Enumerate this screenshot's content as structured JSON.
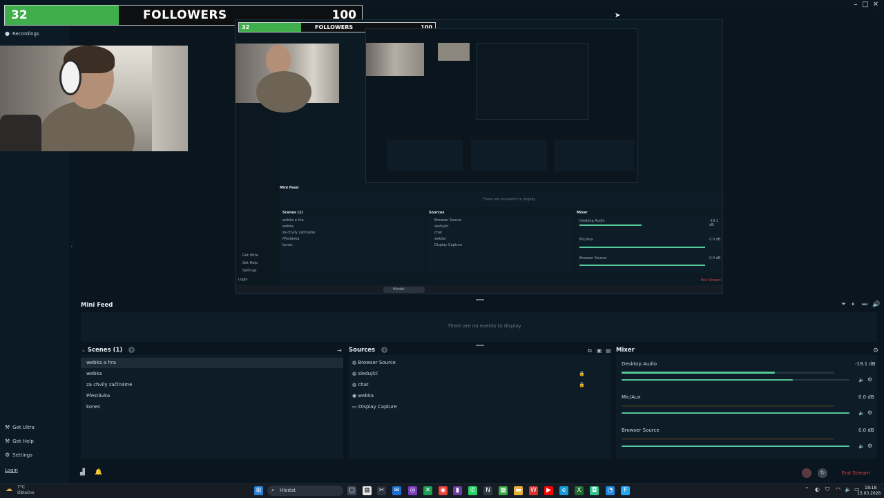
{
  "overlay": {
    "current": "32",
    "label": "FOLLOWERS",
    "goal": "100",
    "progress": 0.32
  },
  "leftnav": {
    "recordings": "Recordings",
    "get_ultra": "Get Ultra",
    "get_help": "Get Help",
    "settings": "Settings",
    "login": "Login"
  },
  "minifeed": {
    "title": "Mini Feed",
    "empty": "There are no events to display"
  },
  "scenes": {
    "title": "Scenes (1)",
    "items": [
      "webka a hra",
      "webka",
      "za chvíly začínáme",
      "Přestávka",
      "konec"
    ]
  },
  "sources": {
    "title": "Sources",
    "items": [
      "Browser Source",
      "sledující",
      "chat",
      "webka",
      "Display Capture"
    ]
  },
  "mixer": {
    "title": "Mixer",
    "channels": [
      {
        "name": "Desktop Audio",
        "db": "-19.1 dB",
        "level": 0.72,
        "vol": 0.75
      },
      {
        "name": "Mic/Aux",
        "db": "0.0 dB",
        "level": 0.0,
        "vol": 1.0
      },
      {
        "name": "Browser Source",
        "db": "0.0 dB",
        "level": 0.0,
        "vol": 1.0
      }
    ]
  },
  "footer": {
    "end_stream": "End Stream"
  },
  "taskbar": {
    "weather_temp": "7°C",
    "weather_desc": "Oblačno",
    "search": "Hledat",
    "time": "18:18",
    "date": "15.03.2026"
  },
  "colors": {
    "accent": "#55c99a",
    "overlay_fill": "#3fae4b",
    "end_stream": "#d9454a",
    "background": "#09161f"
  },
  "nested": {
    "overlay_current": "32",
    "overlay_label": "FOLLOWERS",
    "overlay_goal": "100",
    "minifeed": "Mini Feed",
    "minifeed_empty": "There are no events to display",
    "scenes": "Scenes (1)",
    "scene_items": [
      "webka a hra",
      "webka",
      "za chvíly začínáme",
      "Přestávka",
      "konec"
    ],
    "sources": "Sources",
    "source_items": [
      "Browser Source",
      "sledující",
      "chat",
      "webka",
      "Display Capture"
    ],
    "mixer": "Mixer",
    "mixer_items": [
      "Desktop Audio",
      "Mic/Aux",
      "Browser Source"
    ],
    "mixer_db": [
      "-19.1 dB",
      "0.0 dB",
      "0.0 dB"
    ],
    "end_stream": "End Stream",
    "get_ultra": "Get Ultra",
    "get_help": "Get Help",
    "settings": "Settings",
    "login": "Login",
    "search": "Hledat"
  }
}
